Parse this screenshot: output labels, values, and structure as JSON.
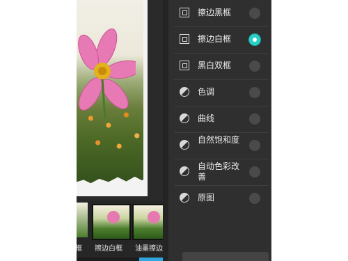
{
  "menu": {
    "items": [
      {
        "label": "擦边黑框",
        "icon": "square-frame-icon",
        "selected": false
      },
      {
        "label": "擦边白框",
        "icon": "square-frame-icon",
        "selected": true
      },
      {
        "label": "黑白双框",
        "icon": "square-frame-icon",
        "selected": false
      },
      {
        "label": "色调",
        "icon": "adjust-circle-icon",
        "selected": false
      },
      {
        "label": "曲线",
        "icon": "adjust-circle-icon",
        "selected": false
      },
      {
        "label": "自然饱和度",
        "icon": "adjust-circle-icon",
        "selected": false
      },
      {
        "label": "自动色彩改善",
        "icon": "adjust-circle-icon",
        "selected": false
      },
      {
        "label": "原图",
        "icon": "original-image-icon",
        "selected": false
      }
    ]
  },
  "thumbs": {
    "left_partial": "框",
    "items": [
      {
        "label": "擦边白框"
      },
      {
        "label": "油墨擦边"
      }
    ]
  },
  "colors": {
    "accent": "#2ad0c6",
    "panel": "#2f2f2f",
    "tab_active": "#2fa6e0"
  }
}
